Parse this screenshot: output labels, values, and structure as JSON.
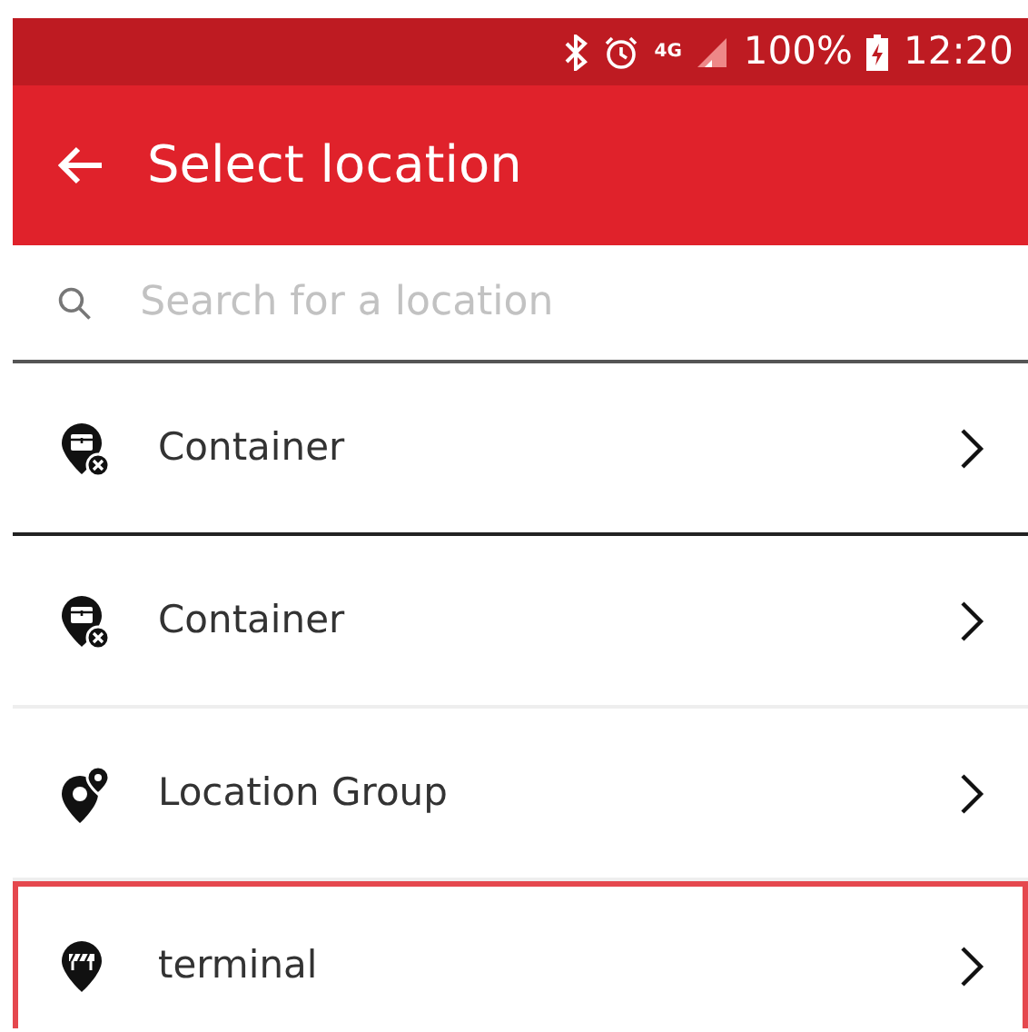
{
  "status_bar": {
    "network": "4G",
    "battery": "100%",
    "time": "12:20"
  },
  "app_bar": {
    "title": "Select location"
  },
  "search": {
    "placeholder": "Search for a location"
  },
  "locations": [
    {
      "label": "Container",
      "kind": "container",
      "selected": false,
      "emphasized_divider": true
    },
    {
      "label": "Container",
      "kind": "container",
      "selected": false,
      "emphasized_divider": false
    },
    {
      "label": "Location Group",
      "kind": "group",
      "selected": false,
      "emphasized_divider": false
    },
    {
      "label": "terminal",
      "kind": "terminal",
      "selected": true,
      "emphasized_divider": false
    }
  ]
}
